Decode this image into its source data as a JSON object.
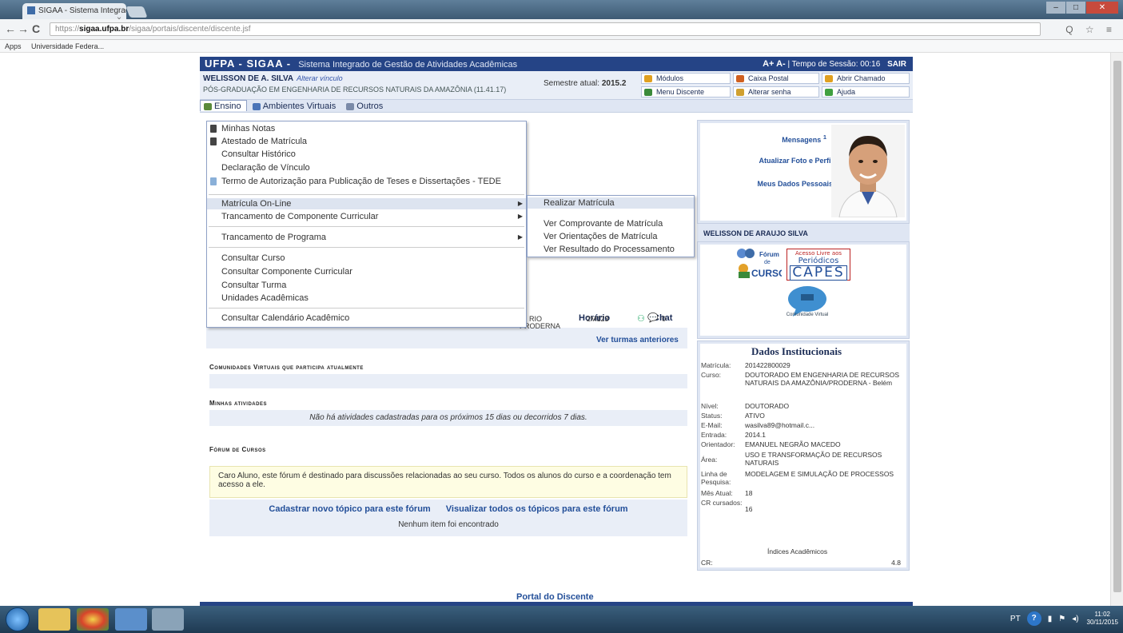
{
  "browser": {
    "tab_title": "SIGAA - Sistema Integrad",
    "tab_close": "×",
    "url_proto": "https://",
    "url_domain": "sigaa.ufpa.br",
    "url_path": "/sigaa/portais/discente/discente.jsf",
    "bookmarks": [
      "Apps",
      "Universidade Federa..."
    ],
    "nav": {
      "back": "←",
      "forward": "→",
      "reload": "C"
    },
    "tool_icons": "Q ☆ ≡"
  },
  "sigaa": {
    "brand": "UFPA - SIGAA -",
    "subtitle": "Sistema Integrado de Gestão de Atividades Acadêmicas",
    "font_controls": "A+ A-",
    "session_label": "| Tempo de Sessão: 00:16",
    "logout": "SAIR",
    "user_name": "WELISSON DE A. SILVA",
    "change_link": "Alterar vínculo",
    "program": "PÓS-GRADUAÇÃO EM ENGENHARIA DE RECURSOS NATURAIS DA AMAZÔNIA (11.41.17)",
    "semester_label": "Semestre atual:",
    "semester_value": "2015.2",
    "quick_buttons": [
      {
        "label": "Módulos",
        "color": "#e0a020"
      },
      {
        "label": "Caixa Postal",
        "color": "#d06020"
      },
      {
        "label": "Abrir Chamado",
        "color": "#e0a020"
      },
      {
        "label": "Menu Discente",
        "color": "#3a8a3a"
      },
      {
        "label": "Alterar senha",
        "color": "#d0a030"
      },
      {
        "label": "Ajuda",
        "color": "#40a040"
      }
    ],
    "menubar": [
      {
        "label": "Ensino",
        "color": "#5a8a3a"
      },
      {
        "label": "Ambientes Virtuais",
        "color": "#4a74b8"
      },
      {
        "label": "Outros",
        "color": "#7a8aa8"
      }
    ]
  },
  "dropdown": {
    "items": [
      {
        "label": "Minhas Notas",
        "icon": "document-icon"
      },
      {
        "label": "Atestado de Matrícula",
        "icon": "document-icon"
      },
      {
        "label": "Consultar Histórico"
      },
      {
        "label": "Declaração de Vínculo"
      },
      {
        "label": "Termo de Autorização para Publicação de Teses e Dissertações - TEDE",
        "icon": "tede-icon"
      },
      {
        "label": "Matrícula On-Line",
        "submenu": true
      },
      {
        "label": "Trancamento de Componente Curricular",
        "submenu": true
      },
      {
        "label": "Trancamento de Programa",
        "submenu": true
      },
      {
        "label": "Consultar Curso"
      },
      {
        "label": "Consultar Componente Curricular"
      },
      {
        "label": "Consultar Turma"
      },
      {
        "label": "Unidades Acadêmicas"
      },
      {
        "label": "Consultar Calendário Acadêmico"
      }
    ],
    "arrow": "▶"
  },
  "submenu": {
    "items": [
      "Realizar Matrícula",
      "Ver Comprovante de Matrícula",
      "Ver Orientações de Matrícula",
      "Ver Resultado do Processamento"
    ]
  },
  "main": {
    "col_horario": "Horário",
    "col_chat": "Chat",
    "row_left_a": "RIO",
    "row_left_b": "PRODERNA",
    "row_horario": "2M123",
    "row_chat_count": "0",
    "ver_turmas": "Ver turmas anteriores",
    "comunidades_title": "Comunidades Virtuais que participa atualmente",
    "atividades_title": "Minhas atividades",
    "atividades_msg": "Não há atividades cadastradas para os próximos 15 dias ou decorridos 7 dias.",
    "forum_title": "Fórum de Cursos",
    "forum_note": "Caro Aluno, este fórum é destinado para discussões relacionadas ao seu curso. Todos os alunos do curso e a coordenação tem acesso a ele.",
    "forum_new": "Cadastrar novo tópico para este fórum",
    "forum_all": "Visualizar todos os tópicos para este fórum",
    "forum_none": "Nenhum item foi encontrado",
    "portal": "Portal do Discente"
  },
  "profile": {
    "mensagens": "Mensagens",
    "mensagens_count": "1",
    "atualizar_foto": "Atualizar Foto e Perfil",
    "meus_dados": "Meus Dados Pessoais",
    "full_name": "WELISSON DE ARAUJO SILVA",
    "forum_label_1": "Fórum",
    "forum_label_2": "de",
    "forum_label_3": "CURSO",
    "capes_line1": "Acesso Livre aos",
    "capes_line2": "Periódicos",
    "capes_line3": "CAPES",
    "comunidade_label": "Comunidade Virtual"
  },
  "dados": {
    "title": "Dados Institucionais",
    "rows": [
      {
        "k": "Matrícula:",
        "v": "201422800029"
      },
      {
        "k": "Curso:",
        "v": "DOUTORADO EM ENGENHARIA DE RECURSOS NATURAIS DA AMAZÔNIA/PRODERNA - Belém"
      },
      {
        "k": "Nível:",
        "v": "DOUTORADO"
      },
      {
        "k": "Status:",
        "v": "ATIVO"
      },
      {
        "k": "E-Mail:",
        "v": "wasilva89@hotmail.c..."
      },
      {
        "k": "Entrada:",
        "v": "2014.1"
      },
      {
        "k": "Orientador:",
        "v": "EMANUEL NEGRÃO MACEDO"
      },
      {
        "k": "Área:",
        "v": "USO E TRANSFORMAÇÃO DE RECURSOS NATURAIS"
      },
      {
        "k": "Linha de Pesquisa:",
        "v": "MODELAGEM E SIMULAÇÃO DE PROCESSOS"
      },
      {
        "k": "Mês Atual:",
        "v": "18"
      },
      {
        "k": "CR cursados:",
        "v": "16"
      }
    ],
    "indices": "Índices Acadêmicos",
    "cr_label": "CR:",
    "cr_value": "4.8"
  },
  "taskbar": {
    "tray_lang": "PT",
    "help": "?",
    "time": "11:02",
    "date": "30/11/2015"
  }
}
